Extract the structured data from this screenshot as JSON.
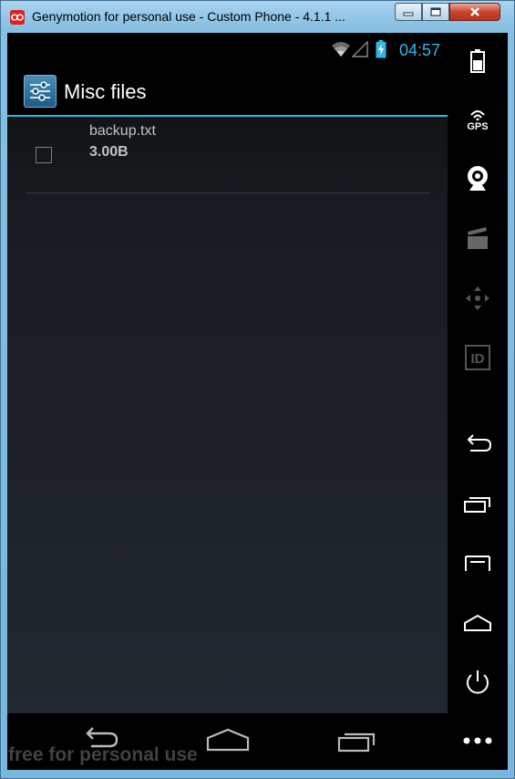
{
  "window": {
    "title": "Genymotion for personal use - Custom Phone - 4.1.1 ...",
    "minimize_icon": "minimize-icon",
    "maximize_icon": "maximize-icon",
    "close_icon": "close-icon"
  },
  "status_bar": {
    "time": "04:57",
    "accent_color": "#33b5e5"
  },
  "action_bar": {
    "title": "Misc files",
    "app_icon": "settings-sliders-icon"
  },
  "files": [
    {
      "name": "backup.txt",
      "size": "3.00B",
      "checked": false
    }
  ],
  "toolbar": {
    "gps_label": "GPS",
    "id_label": "ID"
  },
  "watermark": "free for personal use"
}
